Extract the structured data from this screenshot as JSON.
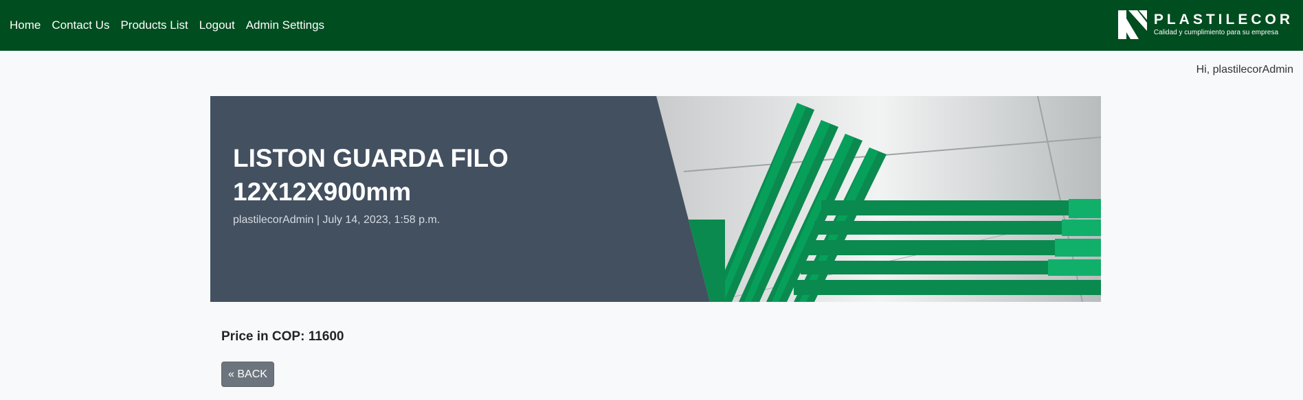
{
  "nav": {
    "home": "Home",
    "contact": "Contact Us",
    "products": "Products List",
    "logout": "Logout",
    "admin": "Admin Settings"
  },
  "brand": {
    "name": "PLASTILECOR",
    "tagline": "Calidad y cumplimiento para su empresa"
  },
  "user": {
    "greeting": "Hi, plastilecorAdmin"
  },
  "product": {
    "title": "LISTON GUARDA FILO 12X12X900mm",
    "meta": "plastilecorAdmin | July 14, 2023, 1:58 p.m.",
    "price_label": "Price in COP:",
    "price_value": "11600",
    "image_icon": "green-plastic-strips-photo"
  },
  "actions": {
    "back_label": "« BACK"
  },
  "colors": {
    "navbar": "#004d1f",
    "hero": "#435060",
    "button": "#6c757d",
    "product_green": "#0a8a4e"
  }
}
